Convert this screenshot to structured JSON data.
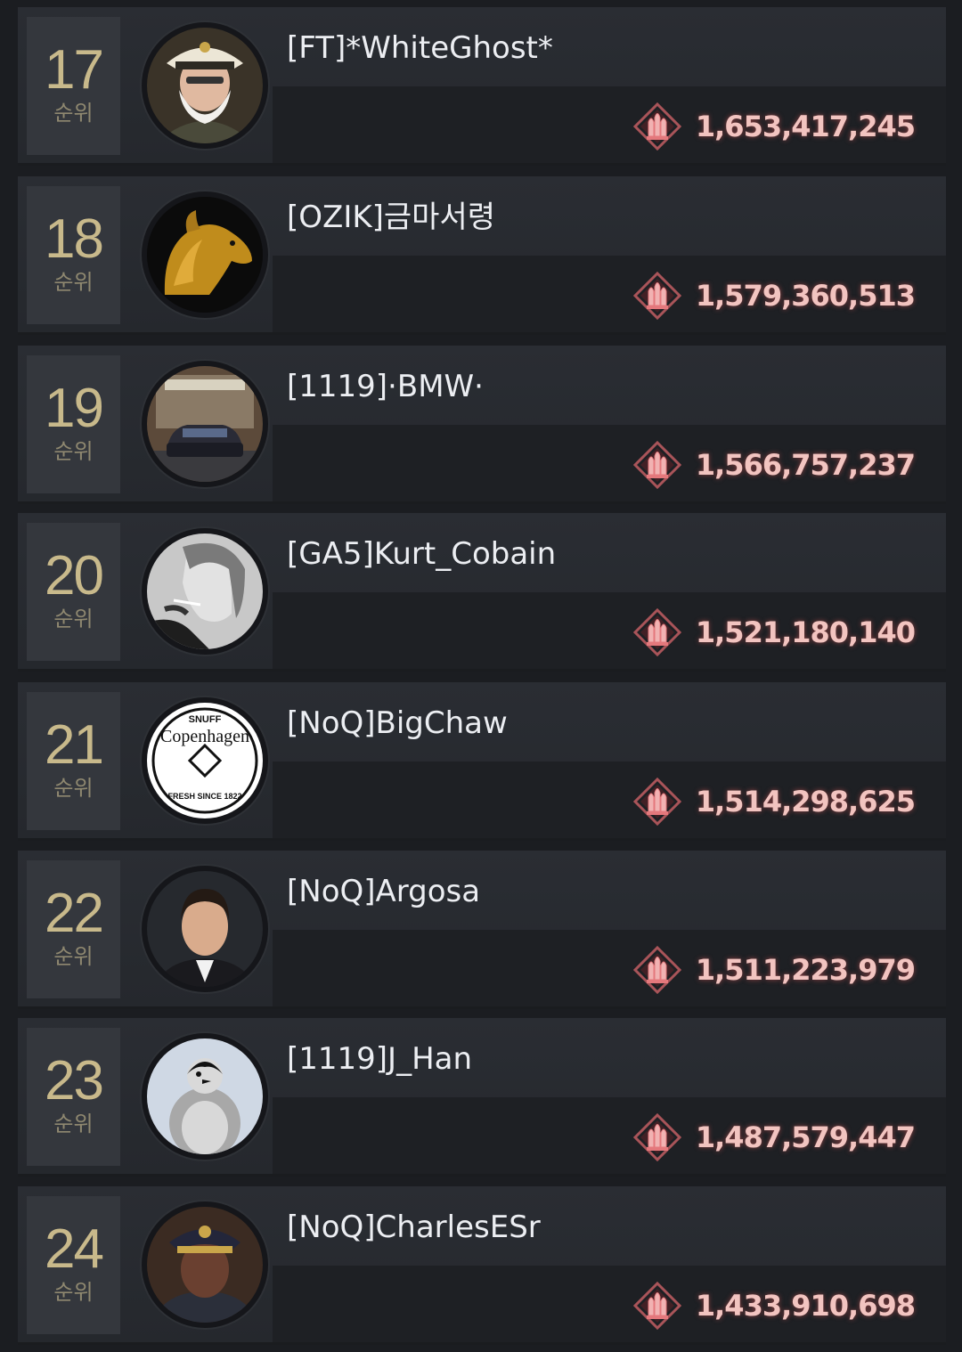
{
  "leaderboard": {
    "rank_suffix": "순위",
    "entries": [
      {
        "rank": "17",
        "name": "[FT]*WhiteGhost*",
        "score": "1,653,417,245",
        "avatar": "admiral-portrait"
      },
      {
        "rank": "18",
        "name": "[OZIK]금마서령",
        "score": "1,579,360,513",
        "avatar": "golden-horse"
      },
      {
        "rank": "19",
        "name": "[1119]·BMW·",
        "score": "1,566,757,237",
        "avatar": "car-in-garage"
      },
      {
        "rank": "20",
        "name": "[GA5]Kurt_Cobain",
        "score": "1,521,180,140",
        "avatar": "smoking-man-bw"
      },
      {
        "rank": "21",
        "name": "[NoQ]BigChaw",
        "score": "1,514,298,625",
        "avatar": "copenhagen-logo"
      },
      {
        "rank": "22",
        "name": "[NoQ]Argosa",
        "score": "1,511,223,979",
        "avatar": "man-in-suit"
      },
      {
        "rank": "23",
        "name": "[1119]J_Han",
        "score": "1,487,579,447",
        "avatar": "penguin-chick"
      },
      {
        "rank": "24",
        "name": "[NoQ]CharlesESr",
        "score": "1,433,910,698",
        "avatar": "officer-portrait"
      }
    ],
    "copenhagen_logo_text": {
      "top": "SNUFF",
      "middle": "Copenhagen",
      "bottom": "FRESH SINCE 1822"
    }
  },
  "colors": {
    "background": "#1b1d21",
    "rank_number": "#c8b98b",
    "score": "#f2c4c0",
    "ammo_icon": "#d9777a"
  },
  "score_icon": "ammo-bullets-icon"
}
